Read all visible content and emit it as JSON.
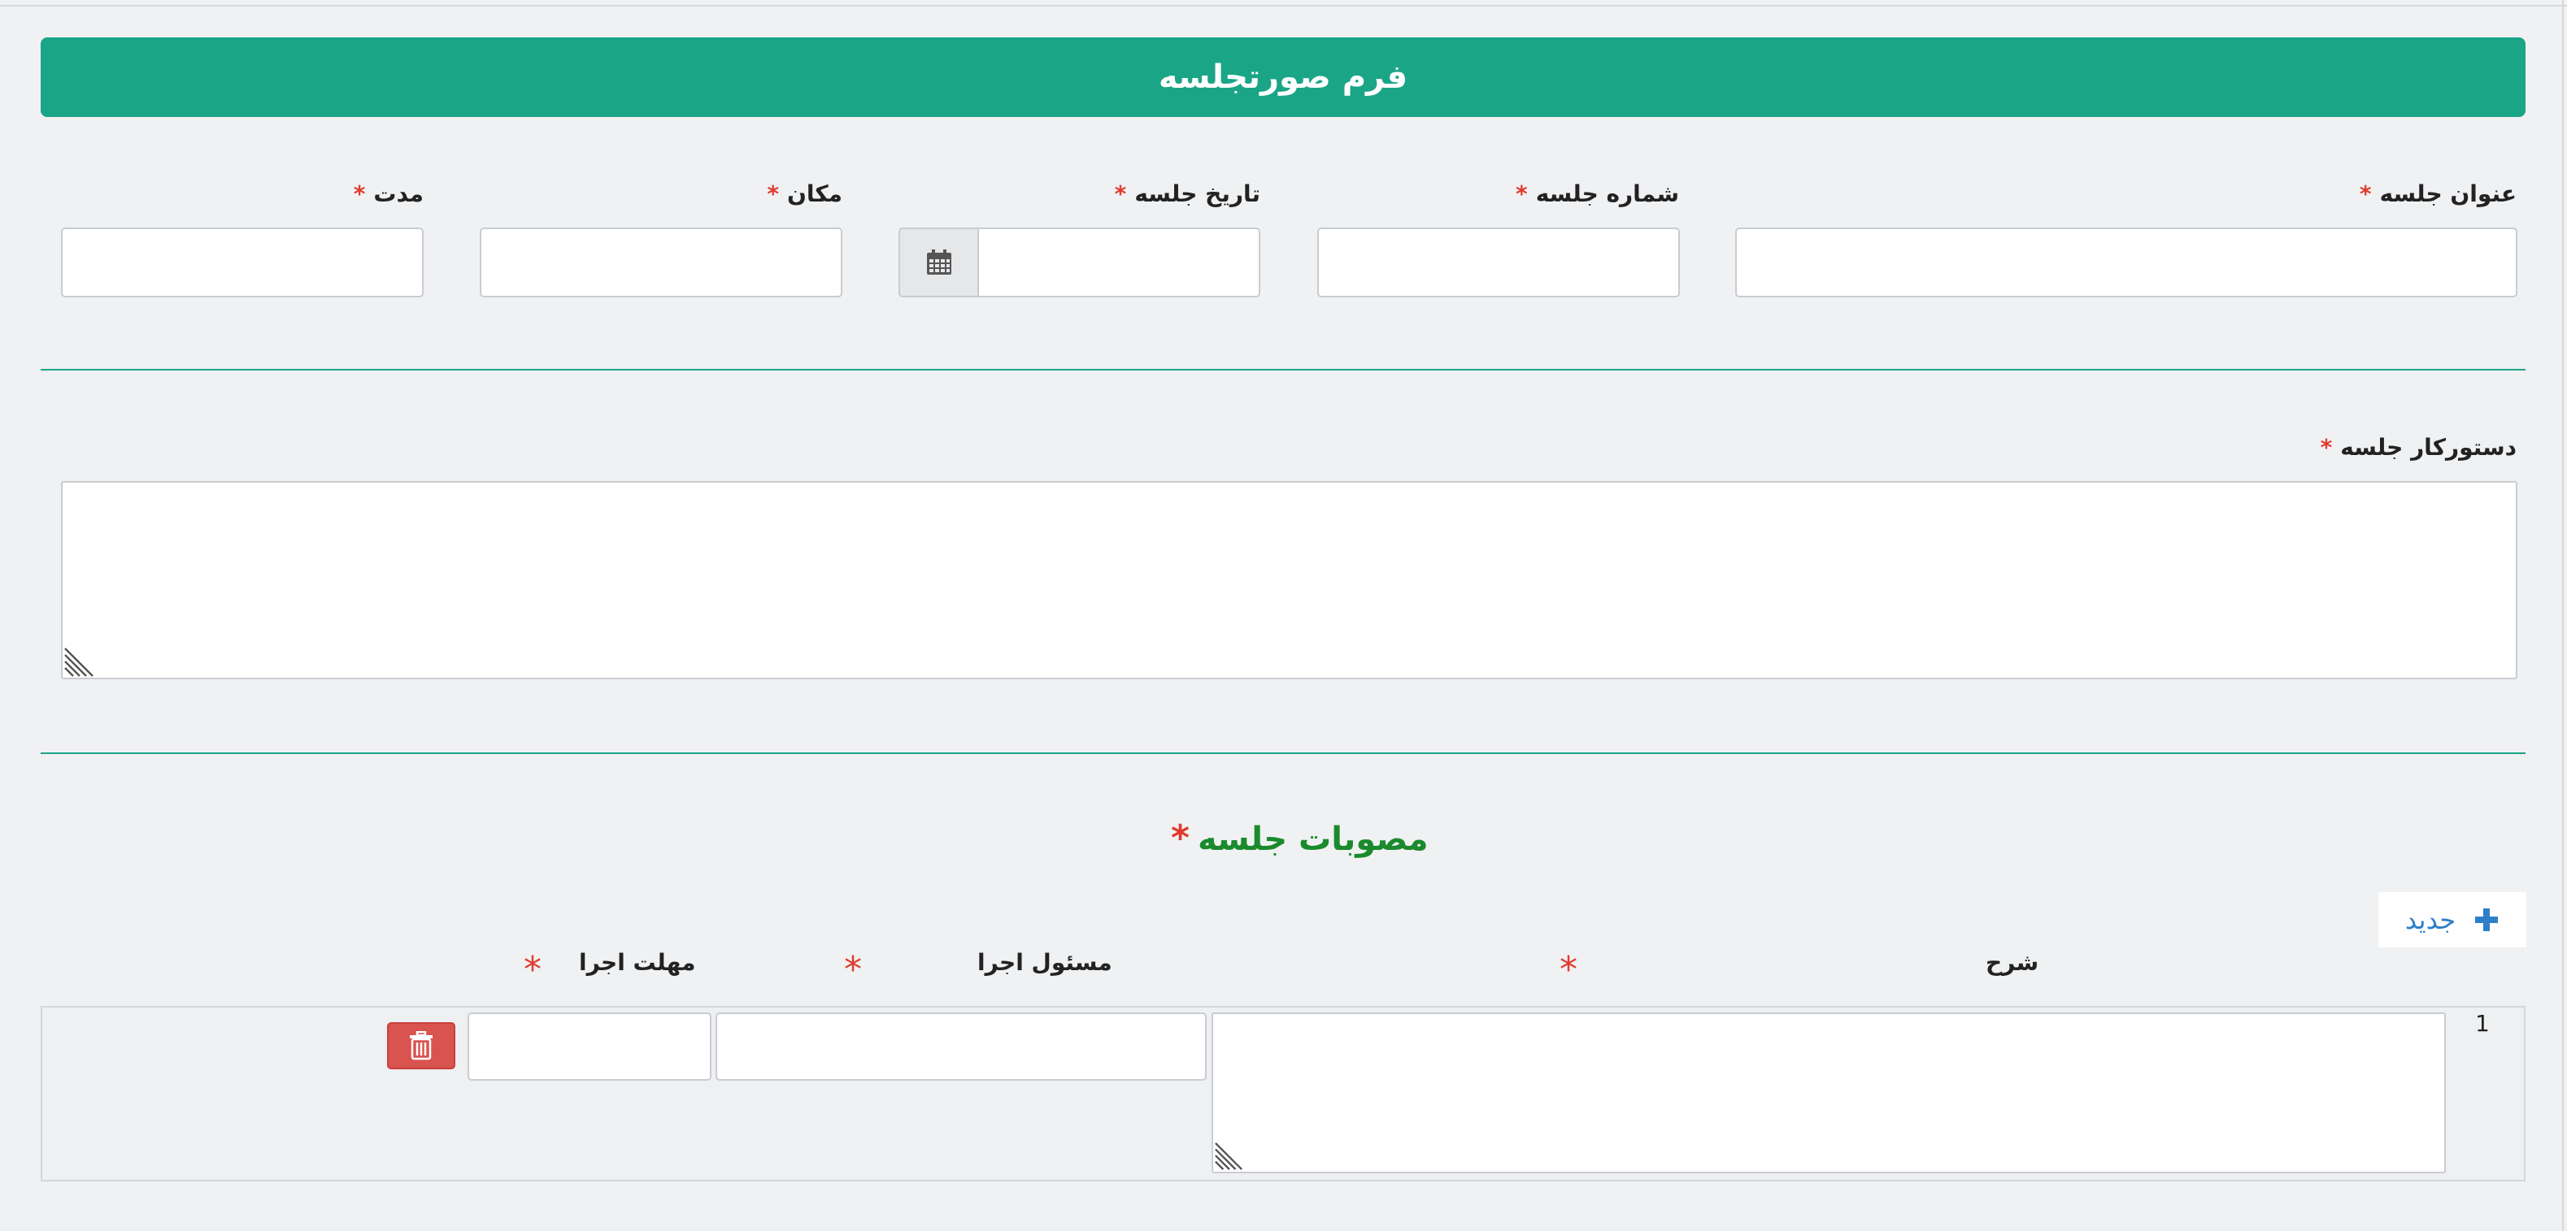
{
  "form": {
    "title": "فرم صورتجلسه",
    "required_mark": "*",
    "fields": {
      "meeting_title": {
        "label": "عنوان جلسه",
        "value": ""
      },
      "meeting_number": {
        "label": "شماره جلسه",
        "value": ""
      },
      "meeting_date": {
        "label": "تاریخ جلسه",
        "value": ""
      },
      "location": {
        "label": "مکان",
        "value": ""
      },
      "duration": {
        "label": "مدت",
        "value": ""
      },
      "agenda": {
        "label": "دستورکار جلسه",
        "value": ""
      }
    }
  },
  "resolutions": {
    "title": "مصوبات جلسه",
    "new_button_label": "جدید",
    "columns": {
      "description": "شرح",
      "responsible": "مسئول اجرا",
      "deadline": "مهلت اجرا"
    },
    "rows": [
      {
        "number": "1",
        "description": "",
        "responsible": "",
        "deadline": ""
      }
    ]
  },
  "colors": {
    "header_bg": "#1ba587",
    "divider": "#1ba587",
    "required_star": "#e03b2e",
    "section_title": "#1b8a2d",
    "link_blue": "#2f7fc8",
    "delete_red": "#d9534f"
  },
  "icons": {
    "calendar": "calendar-icon",
    "plus": "plus-icon",
    "trash": "trash-icon"
  }
}
